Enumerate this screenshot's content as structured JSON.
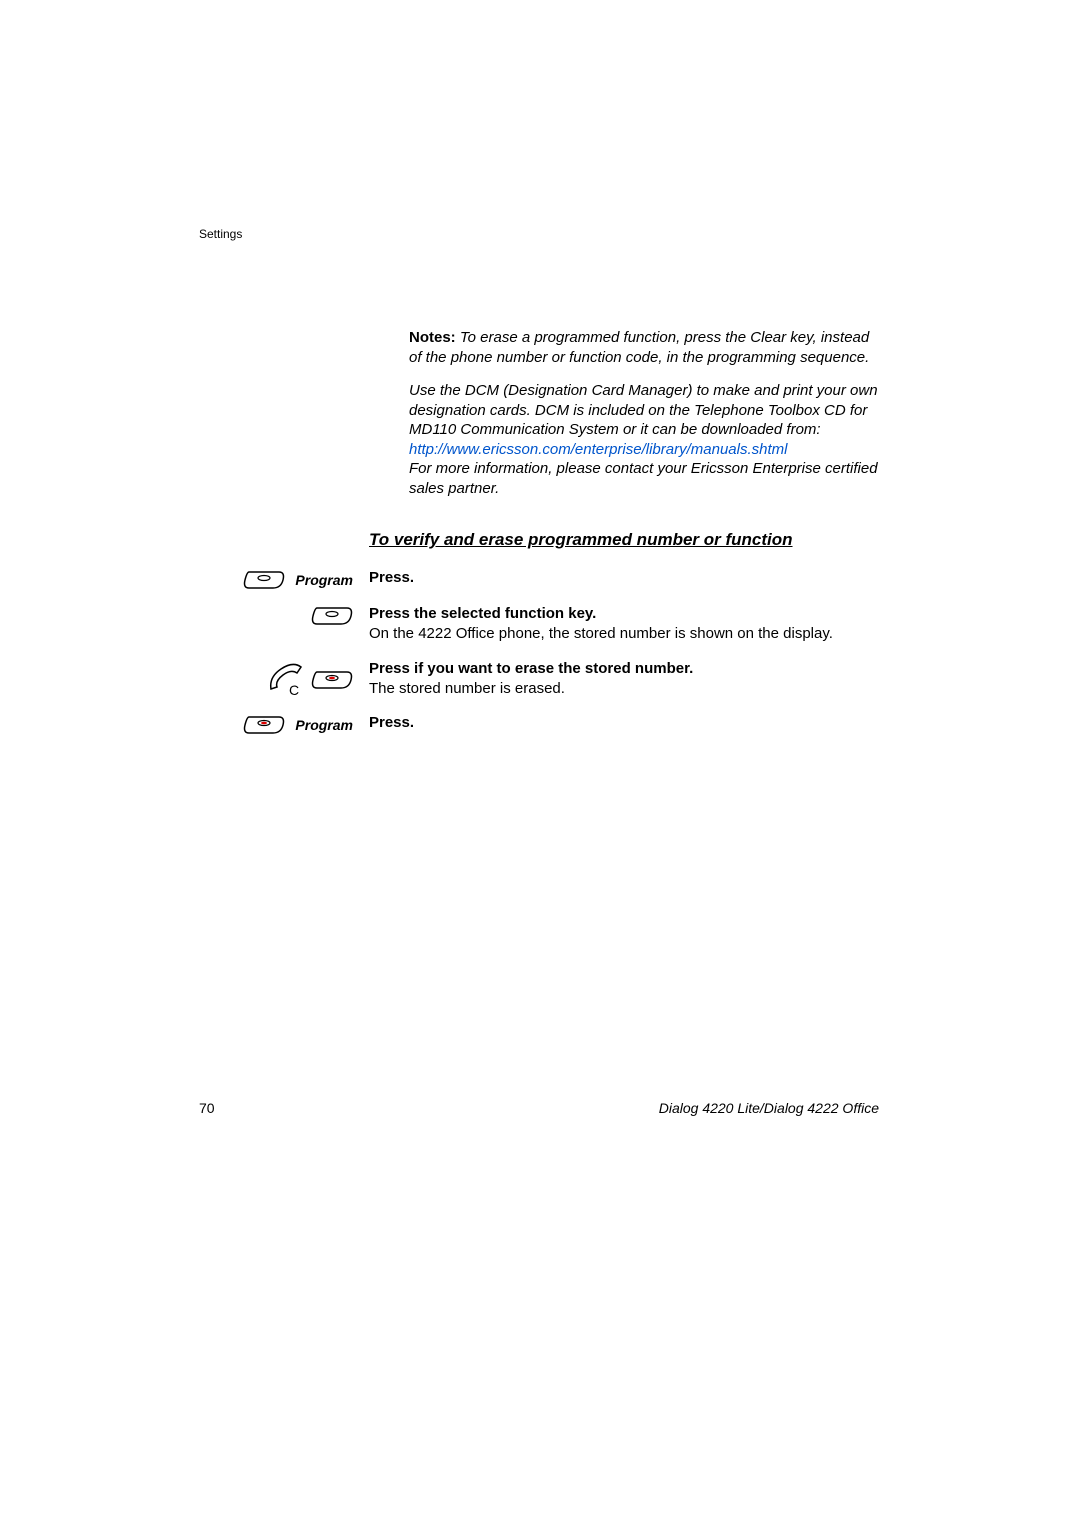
{
  "header": {
    "section": "Settings"
  },
  "notes": {
    "label": "Notes:",
    "text1": "To erase a programmed function, press the Clear key, instead of the phone number or function code, in the programming sequence.",
    "text2": "Use the DCM (Designation Card Manager) to make and print your own designation cards. DCM is included on the Telephone Toolbox CD for MD110 Communication System or it can be downloaded from:",
    "link": "http://www.ericsson.com/enterprise/library/manuals.shtml",
    "text3": "For more information, please contact your Ericsson Enterprise certified sales partner."
  },
  "section_heading": "To verify and erase programmed number or function",
  "steps": {
    "program_label": "Program",
    "step1": {
      "instruction": "Press."
    },
    "step2": {
      "instruction": "Press the selected function key.",
      "detail": "On the 4222 Office phone, the stored number is shown on the display."
    },
    "step3": {
      "instruction": "Press if you want to erase the stored number.",
      "detail": "The stored number is erased."
    },
    "step4": {
      "instruction": "Press."
    }
  },
  "footer": {
    "page": "70",
    "doc": "Dialog 4220 Lite/Dialog 4222 Office"
  }
}
